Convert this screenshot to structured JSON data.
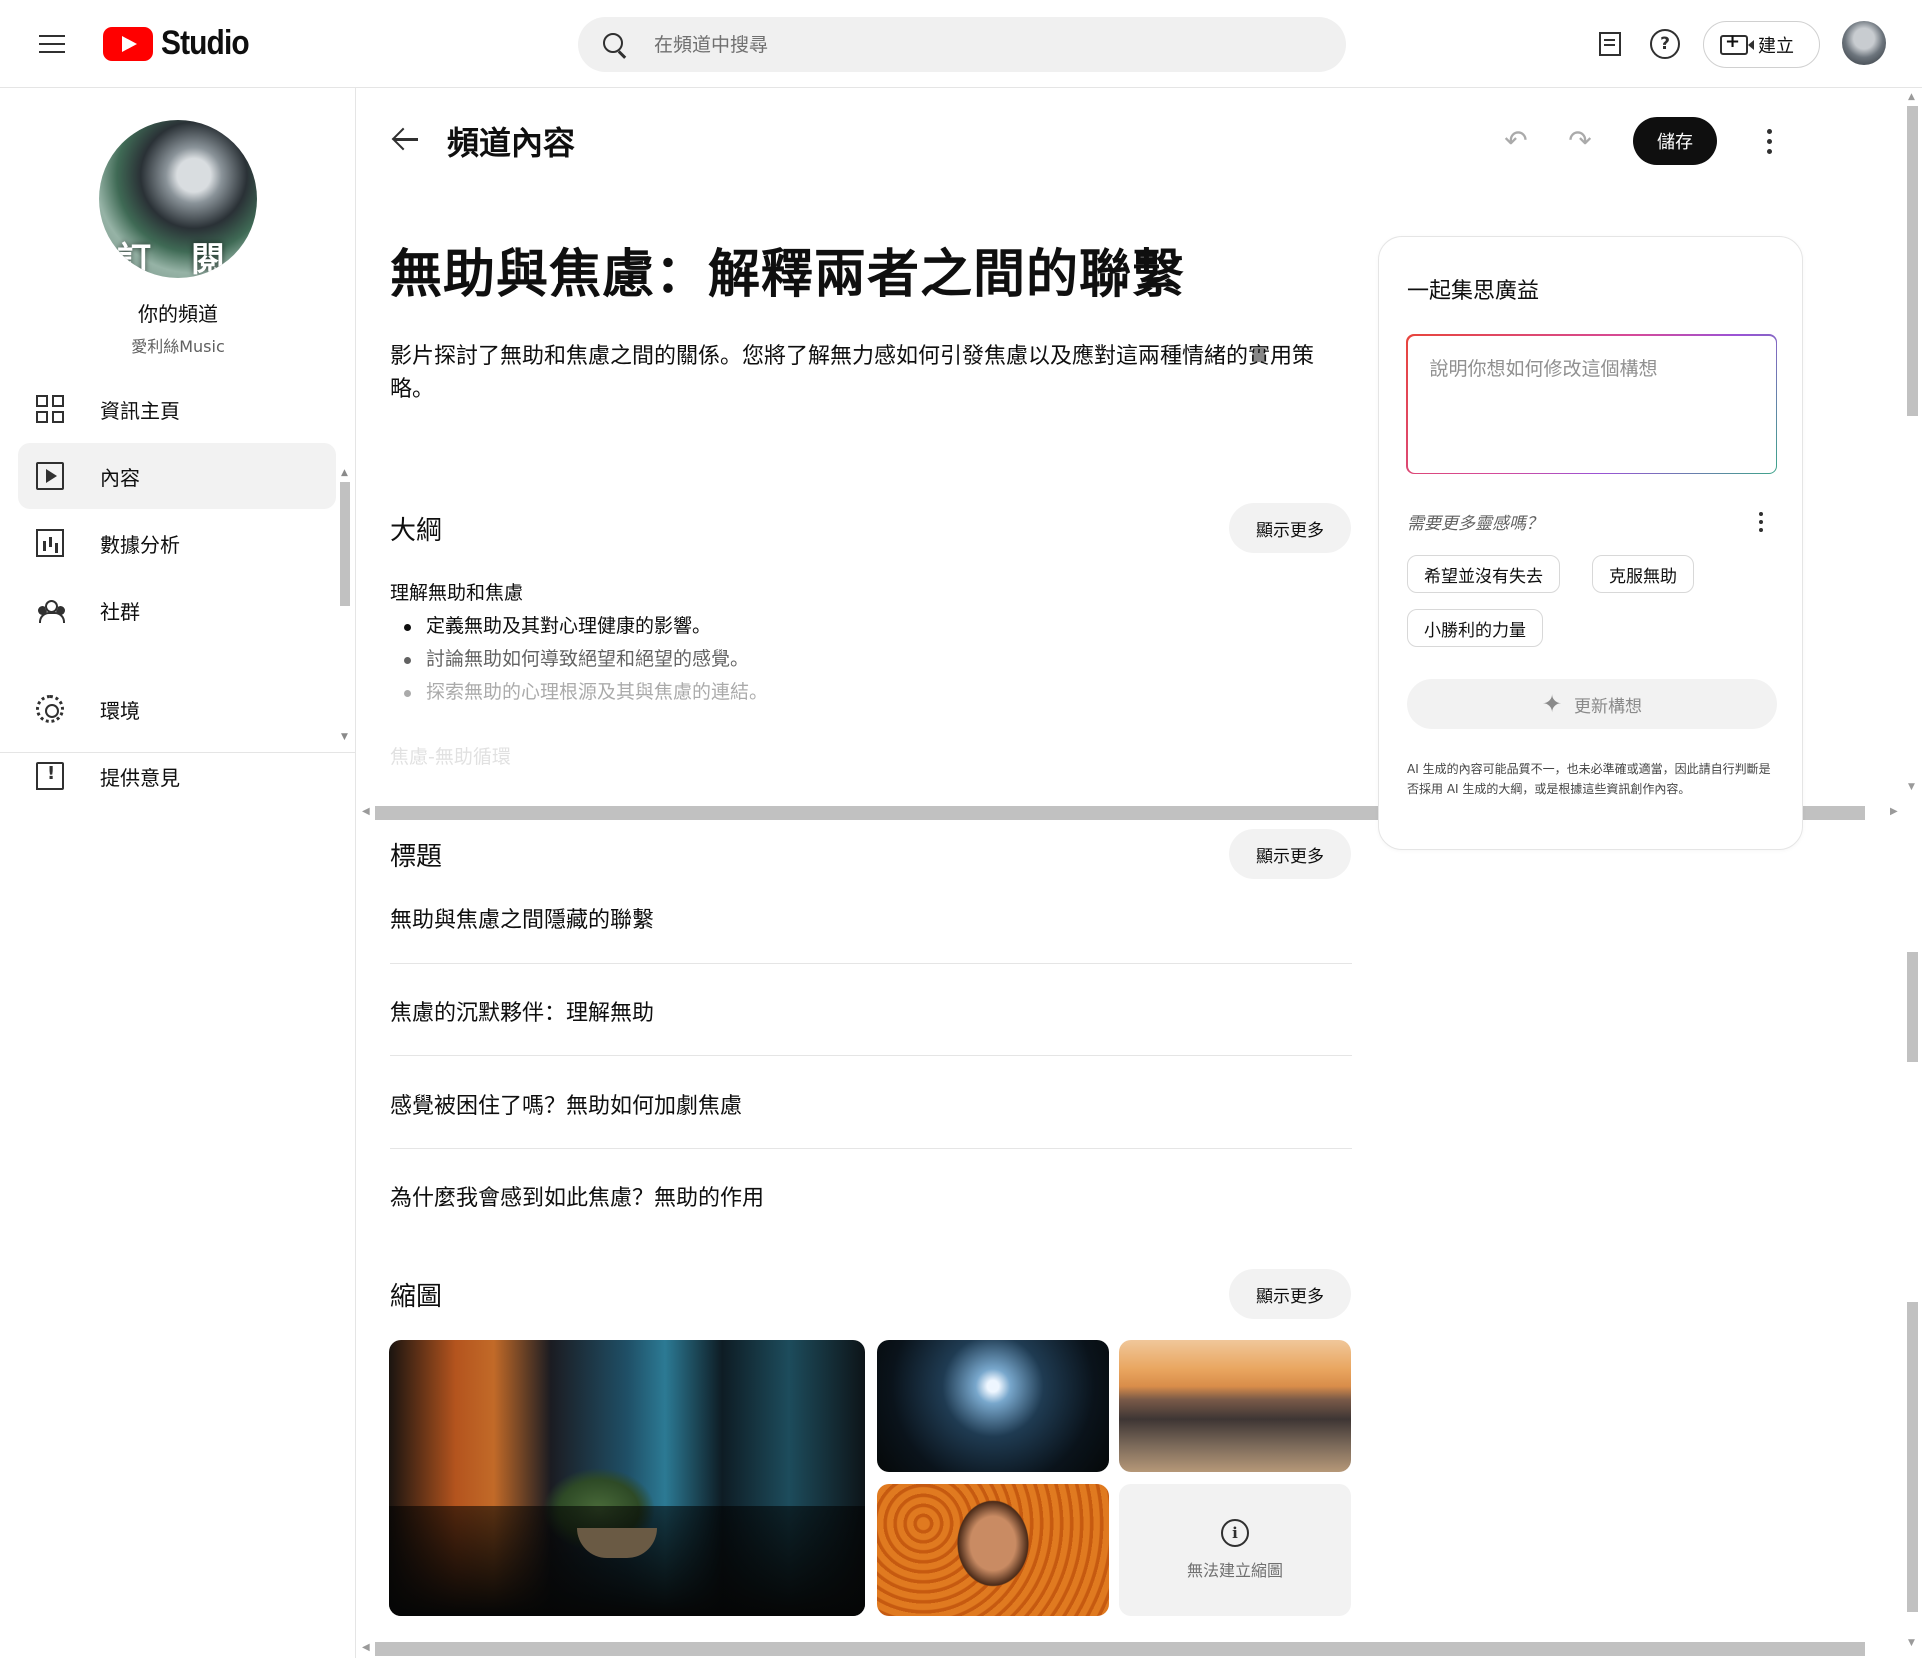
{
  "header": {
    "logo_text": "Studio",
    "search_placeholder": "在頻道中搜尋",
    "create_label": "建立",
    "help_glyph": "?"
  },
  "sidebar": {
    "channel_title": "你的頻道",
    "channel_name": "愛利絲Music",
    "avatar_overlay_text": "訂 閱",
    "items": [
      {
        "label": "資訊主頁",
        "icon": "dashboard-icon"
      },
      {
        "label": "內容",
        "icon": "content-icon",
        "active": true
      },
      {
        "label": "數據分析",
        "icon": "analytics-icon"
      },
      {
        "label": "社群",
        "icon": "community-icon"
      }
    ],
    "bottom_items": [
      {
        "label": "環境",
        "icon": "settings-icon"
      },
      {
        "label": "提供意見",
        "icon": "feedback-icon"
      }
    ]
  },
  "page": {
    "title": "頻道內容",
    "save_label": "儲存",
    "undo_glyph": "↶",
    "redo_glyph": "↷"
  },
  "idea": {
    "title": "無助與焦慮：解釋兩者之間的聯繫",
    "description": "影片探討了無助和焦慮之間的關係。您將了解無力感如何引發焦慮以及應對這兩種情緒的實用策略。"
  },
  "outline": {
    "heading": "大綱",
    "show_more": "顯示更多",
    "subheading": "理解無助和焦慮",
    "points": [
      "定義無助及其對心理健康的影響。",
      "討論無助如何導致絕望和絕望的感覺。",
      "探索無助的心理根源及其與焦慮的連結。"
    ],
    "next_subheading": "焦慮-無助循環"
  },
  "titles": {
    "heading": "標題",
    "show_more": "顯示更多",
    "items": [
      "無助與焦慮之間隱藏的聯繫",
      "焦慮的沉默夥伴：理解無助",
      "感覺被困住了嗎？無助如何加劇焦慮",
      "為什麼我會感到如此焦慮？無助的作用"
    ]
  },
  "thumbnails": {
    "heading": "縮圖",
    "show_more": "顯示更多",
    "failed_text": "無法建立縮圖",
    "info_glyph": "i"
  },
  "brainstorm": {
    "title": "一起集思廣益",
    "prompt_placeholder": "說明你想如何修改這個構想",
    "inspiration": "需要更多靈感嗎？",
    "chips": [
      "希望並沒有失去",
      "克服無助",
      "小勝利的力量"
    ],
    "refresh_label": "更新構想",
    "disclaimer": "AI 生成的內容可能品質不一，也未必準確或適當，因此請自行判斷是否採用 AI 生成的大綱，或是根據這些資訊創作內容。"
  }
}
